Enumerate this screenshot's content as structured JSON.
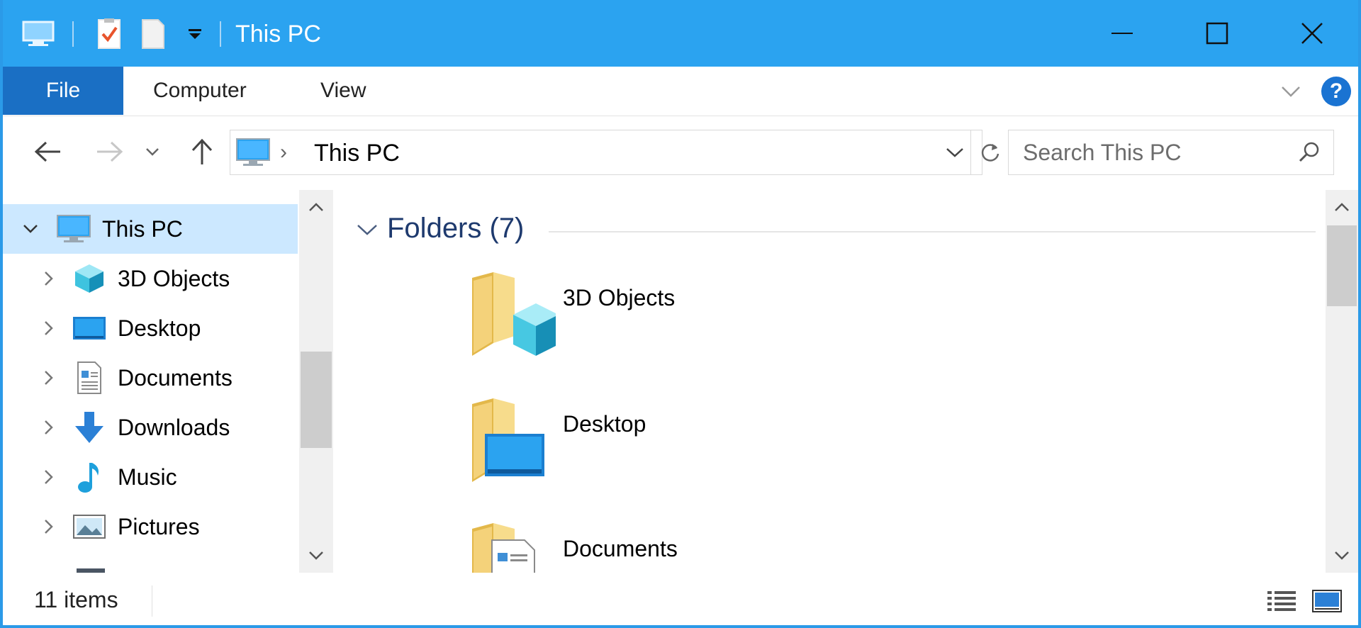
{
  "window": {
    "title": "This PC"
  },
  "ribbon": {
    "tabs": [
      {
        "label": "File"
      },
      {
        "label": "Computer"
      },
      {
        "label": "View"
      }
    ],
    "help_label": "?"
  },
  "address": {
    "path": "This PC",
    "separator": "›"
  },
  "search": {
    "placeholder": "Search This PC"
  },
  "navpane": {
    "items": [
      {
        "label": "This PC",
        "icon": "computer-icon",
        "expanded": true,
        "selected": true
      },
      {
        "label": "3D Objects",
        "icon": "3d-objects-icon"
      },
      {
        "label": "Desktop",
        "icon": "desktop-icon"
      },
      {
        "label": "Documents",
        "icon": "documents-icon"
      },
      {
        "label": "Downloads",
        "icon": "downloads-icon"
      },
      {
        "label": "Music",
        "icon": "music-icon"
      },
      {
        "label": "Pictures",
        "icon": "pictures-icon"
      }
    ]
  },
  "content": {
    "group_title": "Folders (7)",
    "folders": [
      {
        "label": "3D Objects",
        "icon": "folder-3d-objects-icon"
      },
      {
        "label": "Desktop",
        "icon": "folder-desktop-icon"
      },
      {
        "label": "Documents",
        "icon": "folder-documents-icon"
      }
    ]
  },
  "status": {
    "item_count": "11 items"
  },
  "colors": {
    "titlebar": "#2ba3f0",
    "file_tab": "#1a6fc4",
    "selection": "#cce8ff",
    "group_title": "#1e3a6e",
    "folder": "#f4d27a"
  }
}
